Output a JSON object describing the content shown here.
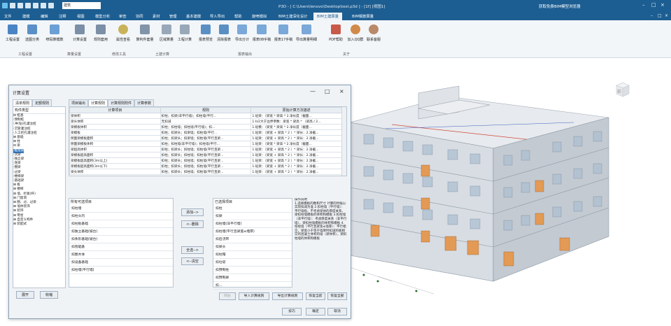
{
  "titlebar": {
    "current": "建筑",
    "title": "P3D - [ C:\\Users\\lenovo\\Desktop\\test.p3d ] - [1f] [视图1]",
    "hint": "获取免费BIM模型浏览器",
    "win_controls": [
      "–",
      "□",
      "×"
    ]
  },
  "menu": {
    "items": [
      "文件",
      "建模",
      "编辑",
      "注释",
      "视图",
      "模型分析",
      "审查",
      "协同",
      "素材",
      "管理",
      "基本建模",
      "导入导出",
      "帮助",
      "旋喷模拟",
      "BIM土建深化设计",
      "BIM土建算量",
      "BIM钢筋算量"
    ],
    "active_index": 15,
    "right": [
      "–",
      "□",
      "×"
    ]
  },
  "ribbon": {
    "buttons": [
      "工程设置",
      "选图分类",
      "喷码算模数",
      "计算设置",
      "规则套用",
      "属性查看",
      "算构件套量",
      "区域算量",
      "工程计算",
      "报表预览",
      "清除报表",
      "导出分计",
      "报表08手稿",
      "报表17手稿",
      "导出算量明细",
      "PDF帮助",
      "加入QQ群",
      "联系客服"
    ],
    "groups": [
      "工程设置",
      "算量设置",
      "修改工具",
      "土建计算",
      "报表输出",
      "关于"
    ]
  },
  "dialog": {
    "title": "计算设置",
    "controls": [
      "—",
      "□",
      "×"
    ],
    "left_tabs": [
      "清单规则",
      "定额规则"
    ],
    "tree_header": "构件类型",
    "tree": [
      "⊟ 桩基",
      "  ·预制桩",
      "  ·冲(钻)孔灌注桩",
      "  ·沉管灌注桩",
      "  ·人工挖孔灌注桩",
      "⊞ 基础",
      "⊞ 柱",
      "⊟ 梁",
      "  ·框架梁",
      "  ·次梁",
      "  ·独立梁",
      "  ·连梁",
      "  ·圈梁",
      "  ·过梁",
      "  ·楼梯梁",
      "  ·基础梁",
      "⊞ 板",
      "⊞ 楼梯",
      "⊞ 墙、栏板(杆)",
      "⊞ 门窗洞",
      "⊞ 圈、过、过梁",
      "⊞ 墙体装饰",
      "⊞ 装饰",
      "⊞ 零星",
      "⊞ 自定义构件",
      "⊞ 装配式"
    ],
    "tree_selected": 8,
    "tree_buttons": [
      "展开",
      "收缩"
    ],
    "right_tabs": [
      "项目输出",
      "计算规则",
      "计算规则附件",
      "计算参数"
    ],
    "right_active": 1,
    "grid_headers": [
      "计算项目",
      "规则",
      "原始计算方法描述"
    ],
    "grid_rows": [
      [
        "梁体积",
        "扣柱；扣梁(非平行墙)；扣柱墙(平行...",
        "1.砼梁：（梁宽 * 梁高 * 2.净长度（截面..."
      ],
      [
        "梁头体积",
        "无扣减",
        "1.h/2大于边界参数：梁宽 * 梁高 * （梁高 / 2..."
      ],
      [
        "梁模板体积",
        "扣柱；扣柱墙；扣柱墙(平行墙)；扣...",
        "1.砼模：（梁宽 * 梁高 * 2.净长度（截面..."
      ],
      [
        "梁模板",
        "扣柱；扣梁头；扣梁墙；扣柱墙(平行...",
        "1.砼梁：（梁宽 + 梁高 * 2 ）* 梁长：2.净截..."
      ],
      [
        "侧面梁模板面积",
        "扣柱；扣梁头；扣梁墙；扣柱墙(平行且梁...",
        "1.砼梁：（梁宽 + 梁高 * 2 ）* 梁长：2.净截..."
      ],
      [
        "侧面梁模板体积",
        "扣柱；扣柱墙(非平行墙)；扣柱墙(平行...",
        "1.砼梁：（梁宽 * 梁高 * 2.净长度（截面..."
      ],
      [
        "梁超高体积",
        "扣柱；扣梁头；扣柱墙；扣柱墙(平行且梁...",
        "1.砼梁：（梁宽 + 梁高 * 2 ）* 梁长：2.净截..."
      ],
      [
        "梁模板超高面积",
        "扣柱；扣梁头；扣柱墙；扣柱墙(平行且梁...",
        "1.砼梁：（梁宽 + 梁高 * 2 ）* 梁长：2.净截..."
      ],
      [
        "梁模板超高面积(3m以上)",
        "扣柱；扣梁头；扣柱墙；扣柱墙(平行且梁...",
        "1.砼梁：（梁宽 + 梁高 * 2 ）* 梁长：2.净截..."
      ],
      [
        "梁模板超高面积(3m以下)",
        "扣柱；扣梁头；扣柱墙；扣柱墙(平行且梁...",
        "1.砼梁：（梁宽 + 梁高 * 2 ）* 梁长：2.净截..."
      ],
      [
        "梁头体积",
        "扣柱；扣梁头；扣柱墙；扣柱墙(平行且梁...",
        "1.砼梁：（梁宽 + 梁高 * 2 ）* 梁长：2.净截..."
      ]
    ],
    "all_items_label": "所有可选项目",
    "all_items": [
      "扣柱墙",
      "扣柱头内",
      "扣柱板基础",
      "扣独立基础(坡台)",
      "扣条形基础(坡台)",
      "扣筏础基",
      "扣圈木体",
      "扣设备基础",
      "扣柱墙(平行墙)"
    ],
    "selected_label": "已选择项目",
    "selected_items": [
      "扣柱",
      "扣梁",
      "扣柱墙(非平行墙)",
      "扣柱墙(平行且梁宽≤墙厚)",
      "扣后浇带",
      "扣梁头",
      "扣柱帽",
      "扣垃圾",
      "扣预制柱",
      "扣预制梁",
      "扣..."
    ],
    "mid_buttons": [
      "添加-->",
      "<--删除",
      "全选-->",
      "<--清空"
    ],
    "desc_label": "操作说明",
    "desc_text": "1.选择模板的数和尺寸 计算的时候以实际扣减为准 2.扣柱墙（平行墙）：平行墙指，不考虑梁体的厚度关系，梁扣柱墙模板的体积和模板 3.扣柱墙（非平行墙）：考虑厚度关系（非平行墙），梁扣柱墙模板的体积和模板 4.扣柱墙（平行且梁宽≤墙厚）：平行相交，梁宽小于等于墙厚时扣减的板相交的混凝土体积的墙（梁体积），梁扣柱墙的体积和模板",
    "bottom_buttons": [
      "同左",
      "导入计算规则",
      "导出计算规则",
      "恢复当前",
      "恢复全部"
    ],
    "footer_buttons": [
      "技巧",
      "确定",
      "取消"
    ]
  },
  "viewcube": {
    "face": "前"
  }
}
